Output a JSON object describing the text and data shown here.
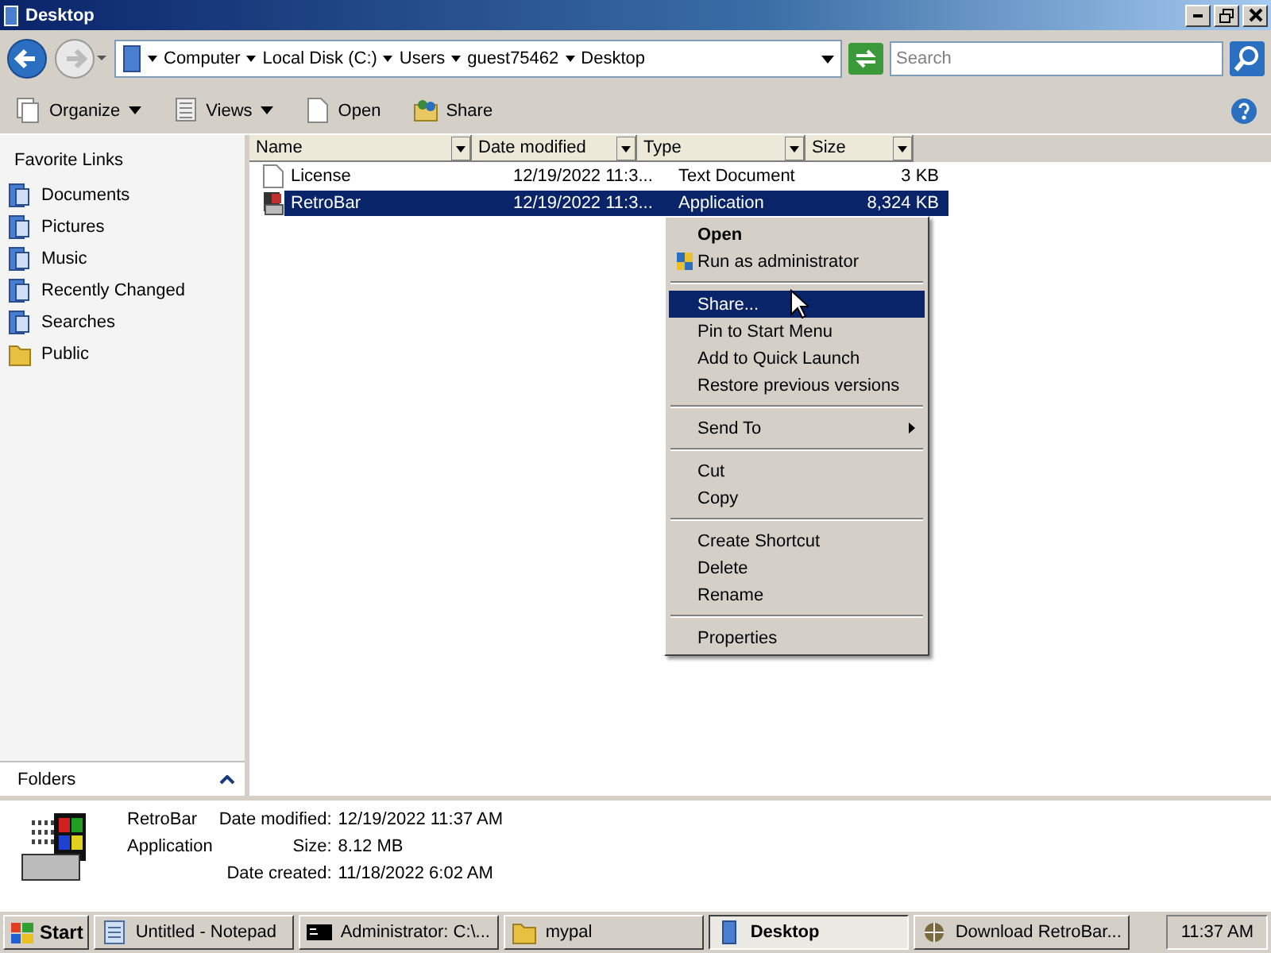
{
  "window": {
    "title": "Desktop"
  },
  "address": {
    "crumbs": [
      "Computer",
      "Local Disk (C:)",
      "Users",
      "guest75462",
      "Desktop"
    ]
  },
  "search": {
    "placeholder": "Search"
  },
  "toolbar": [
    {
      "label": "Organize",
      "dropdown": true
    },
    {
      "label": "Views",
      "dropdown": true
    },
    {
      "label": "Open",
      "dropdown": false
    },
    {
      "label": "Share",
      "dropdown": false
    }
  ],
  "sidebar": {
    "title": "Favorite Links",
    "items": [
      "Documents",
      "Pictures",
      "Music",
      "Recently Changed",
      "Searches",
      "Public"
    ],
    "folders_label": "Folders"
  },
  "table": {
    "columns": [
      "Name",
      "Date modified",
      "Type",
      "Size"
    ],
    "rows": [
      {
        "name": "License",
        "date": "12/19/2022 11:3...",
        "type": "Text Document",
        "size": "3 KB",
        "selected": false
      },
      {
        "name": "RetroBar",
        "date": "12/19/2022 11:3...",
        "type": "Application",
        "size": "8,324 KB",
        "selected": true
      }
    ]
  },
  "context_menu": [
    {
      "kind": "item",
      "label": "Open",
      "default": true,
      "selected": false
    },
    {
      "kind": "item",
      "label": "Run as administrator",
      "default": false,
      "selected": false
    },
    {
      "kind": "separator"
    },
    {
      "kind": "item",
      "label": "Share...",
      "default": false,
      "selected": true
    },
    {
      "kind": "item",
      "label": "Pin to Start Menu",
      "default": false,
      "selected": false
    },
    {
      "kind": "item",
      "label": "Add to Quick Launch",
      "default": false,
      "selected": false
    },
    {
      "kind": "item",
      "label": "Restore previous versions",
      "default": false,
      "selected": false
    },
    {
      "kind": "separator"
    },
    {
      "kind": "submenu",
      "label": "Send To",
      "default": false,
      "selected": false
    },
    {
      "kind": "separator"
    },
    {
      "kind": "item",
      "label": "Cut",
      "default": false,
      "selected": false
    },
    {
      "kind": "item",
      "label": "Copy",
      "default": false,
      "selected": false
    },
    {
      "kind": "separator"
    },
    {
      "kind": "item",
      "label": "Create Shortcut",
      "default": false,
      "selected": false
    },
    {
      "kind": "item",
      "label": "Delete",
      "default": false,
      "selected": false
    },
    {
      "kind": "item",
      "label": "Rename",
      "default": false,
      "selected": false
    },
    {
      "kind": "separator"
    },
    {
      "kind": "item",
      "label": "Properties",
      "default": false,
      "selected": false
    }
  ],
  "details": {
    "name": "RetroBar",
    "type": "Application",
    "fields": [
      {
        "label": "Date modified:",
        "value": "12/19/2022 11:37 AM"
      },
      {
        "label": "Size:",
        "value": "8.12 MB"
      },
      {
        "label": "Date created:",
        "value": "11/18/2022 6:02 AM"
      }
    ]
  },
  "taskbar": {
    "start": "Start",
    "buttons": [
      {
        "label": "Untitled - Notepad",
        "selected": false
      },
      {
        "label": "Administrator: C:\\...",
        "selected": false
      },
      {
        "label": "mypal",
        "selected": false
      },
      {
        "label": "Desktop",
        "selected": true
      },
      {
        "label": "Download RetroBar...",
        "selected": false
      }
    ],
    "clock": "11:37 AM"
  }
}
